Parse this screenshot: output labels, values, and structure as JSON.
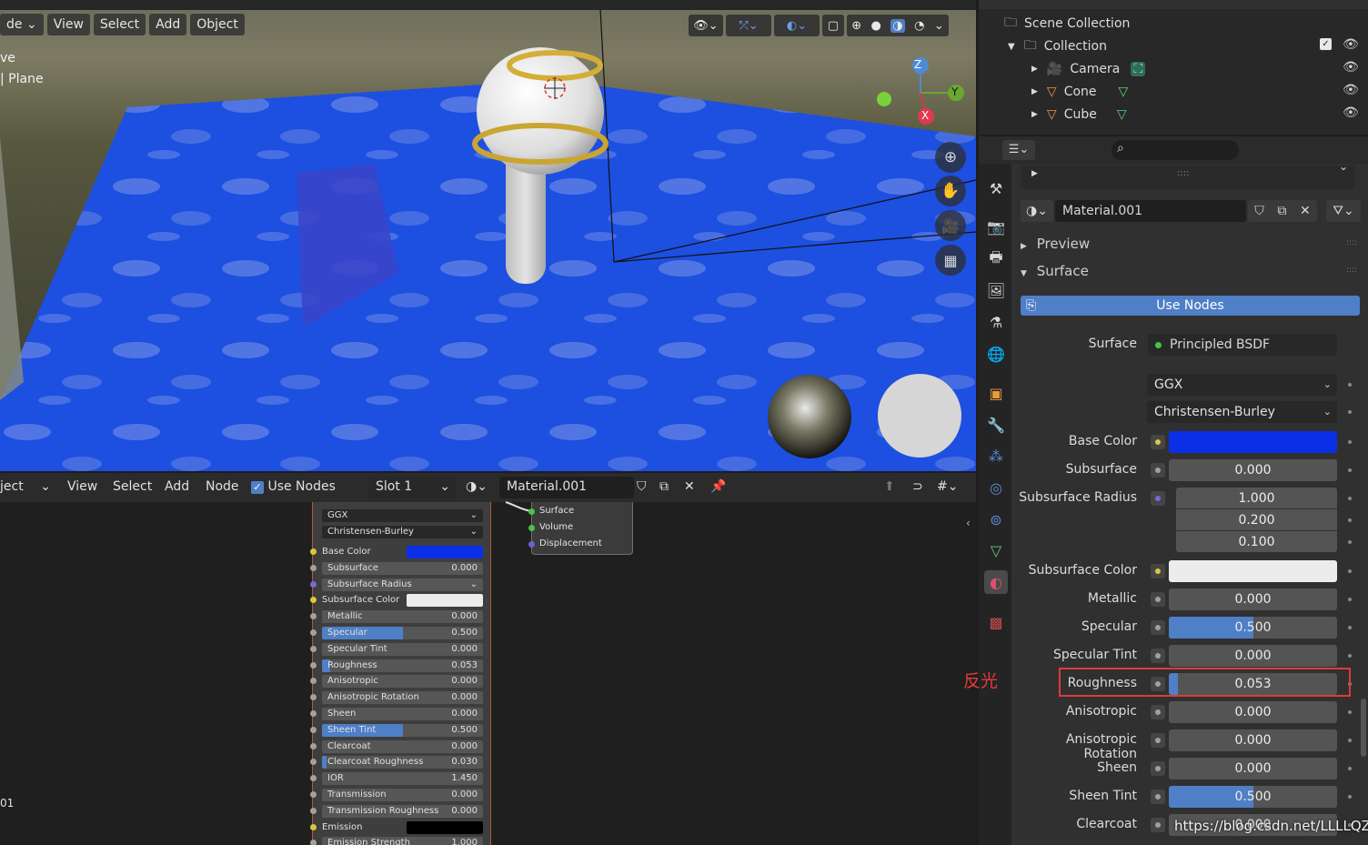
{
  "colors": {
    "accent": "#4f7fc6",
    "base_color": "#0a2fe6",
    "subsurface_color": "#ececec",
    "emission": "#000000",
    "highlight_box": "#e03a3a"
  },
  "viewport": {
    "mode_partial": "de",
    "menu": [
      "View",
      "Select",
      "Add",
      "Object"
    ],
    "info_line1": "ve",
    "info_line2": "| Plane",
    "gizmo": {
      "z": "Z",
      "y": "Y",
      "x": "X"
    }
  },
  "outliner": {
    "scene_collection": "Scene Collection",
    "collection": "Collection",
    "items": [
      {
        "name": "Camera",
        "icon": "camera-icon"
      },
      {
        "name": "Cone",
        "icon": "cone-icon"
      },
      {
        "name": "Cube",
        "icon": "cube-icon"
      }
    ]
  },
  "properties": {
    "tab_dots": "::::",
    "material_name": "Material.001",
    "preview_label": "Preview",
    "surface_section": "Surface",
    "use_nodes_button": "Use Nodes",
    "surface_label": "Surface",
    "surface_shader": "Principled BSDF",
    "distribution": "GGX",
    "subsurface_method": "Christensen-Burley",
    "rows": [
      {
        "label": "Base Color",
        "type": "color",
        "socket": "yellow"
      },
      {
        "label": "Subsurface",
        "type": "value",
        "value": "0.000",
        "fill": 0
      },
      {
        "label": "Subsurface Radius",
        "type": "vector",
        "values": [
          "1.000",
          "0.200",
          "0.100"
        ]
      },
      {
        "label": "Subsurface Color",
        "type": "color2",
        "socket": "yellow"
      },
      {
        "label": "Metallic",
        "type": "value",
        "value": "0.000",
        "fill": 0
      },
      {
        "label": "Specular",
        "type": "value",
        "value": "0.500",
        "fill": 0.5
      },
      {
        "label": "Specular Tint",
        "type": "value",
        "value": "0.000",
        "fill": 0
      },
      {
        "label": "Roughness",
        "type": "value",
        "value": "0.053",
        "fill": 0.053
      },
      {
        "label": "Anisotropic",
        "type": "value",
        "value": "0.000",
        "fill": 0
      },
      {
        "label": "Anisotropic Rotation",
        "type": "value",
        "value": "0.000",
        "fill": 0
      },
      {
        "label": "Sheen",
        "type": "value",
        "value": "0.000",
        "fill": 0
      },
      {
        "label": "Sheen Tint",
        "type": "value",
        "value": "0.500",
        "fill": 0.5
      },
      {
        "label": "Clearcoat",
        "type": "value",
        "value": "0.000",
        "fill": 0
      }
    ]
  },
  "node_editor": {
    "editor_partial": "ject",
    "menu": [
      "View",
      "Select",
      "Add",
      "Node"
    ],
    "use_nodes": "Use Nodes",
    "slot": "Slot 1",
    "material_name": "Material.001",
    "side_label": "01",
    "bsdf": {
      "distribution": "GGX",
      "subsurface_method": "Christensen-Burley",
      "rows": [
        {
          "label": "Base Color",
          "kind": "color",
          "color": "#0a2fe6"
        },
        {
          "label": "Subsurface",
          "value": "0.000",
          "fill": 0
        },
        {
          "label": "Subsurface Radius",
          "kind": "dropdown"
        },
        {
          "label": "Subsurface Color",
          "kind": "color",
          "color": "#ececec"
        },
        {
          "label": "Metallic",
          "value": "0.000",
          "fill": 0
        },
        {
          "label": "Specular",
          "value": "0.500",
          "fill": 0.5
        },
        {
          "label": "Specular Tint",
          "value": "0.000",
          "fill": 0
        },
        {
          "label": "Roughness",
          "value": "0.053",
          "fill": 0.053
        },
        {
          "label": "Anisotropic",
          "value": "0.000",
          "fill": 0
        },
        {
          "label": "Anisotropic Rotation",
          "value": "0.000",
          "fill": 0
        },
        {
          "label": "Sheen",
          "value": "0.000",
          "fill": 0
        },
        {
          "label": "Sheen Tint",
          "value": "0.500",
          "fill": 0.5
        },
        {
          "label": "Clearcoat",
          "value": "0.000",
          "fill": 0
        },
        {
          "label": "Clearcoat Roughness",
          "value": "0.030",
          "fill": 0.03
        },
        {
          "label": "IOR",
          "value": "1.450",
          "fill": 0
        },
        {
          "label": "Transmission",
          "value": "0.000",
          "fill": 0
        },
        {
          "label": "Transmission Roughness",
          "value": "0.000",
          "fill": 0
        },
        {
          "label": "Emission",
          "kind": "color",
          "color": "#000000"
        },
        {
          "label": "Emission Strength",
          "value": "1.000",
          "fill": 0
        }
      ]
    },
    "output_sockets": [
      "Surface",
      "Volume",
      "Displacement"
    ]
  },
  "annotation": "反光",
  "watermark": "https://blog.csdn.net/LLLLQZ"
}
